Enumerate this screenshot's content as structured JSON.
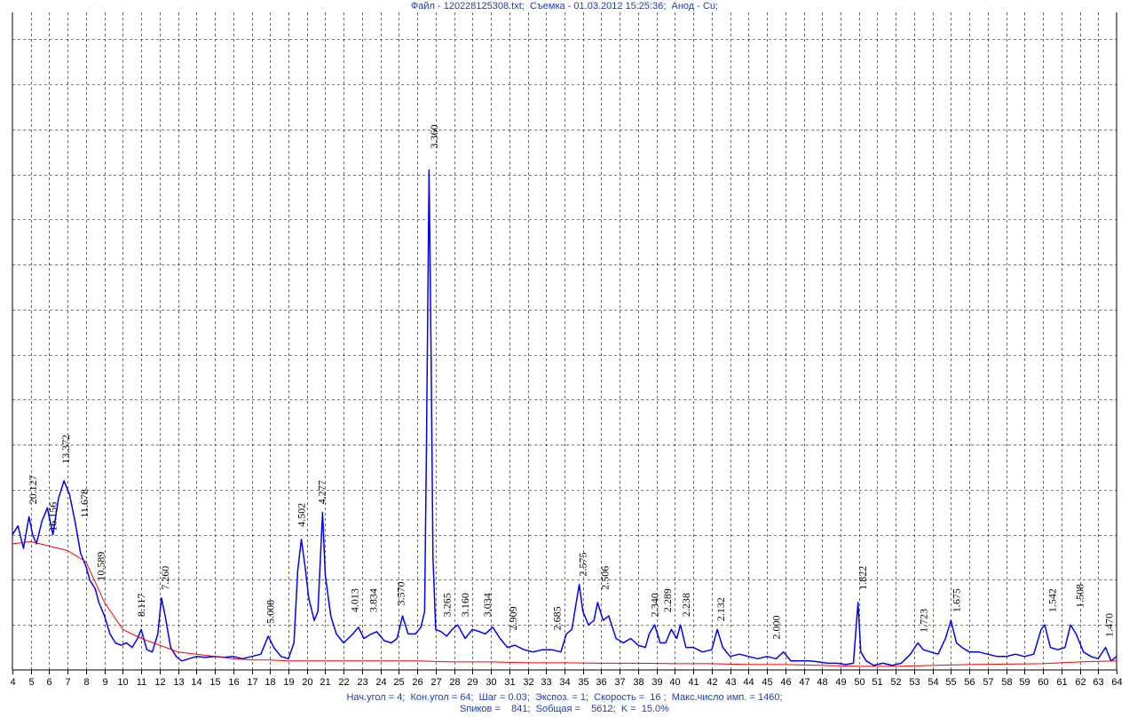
{
  "header": {
    "title": "Файл - 120228125308.txt;  Съемка - 01.03.2012 15:25:36;  Анод - Cu;"
  },
  "footer": {
    "line1": "Нач.угол = 4;  Кон.угол = 64;  Шаг = 0.03;  Экспоз. = 1;  Скорость =  16 ;  Макс.число имп. = 1460;",
    "line2": "Sпиков =    841;  Sобщая =    5612;  K =  15.0%"
  },
  "colors": {
    "trace": "#0000ff",
    "background_line": "#ff0000",
    "text": "#1a3fb8",
    "grid": "#000000"
  },
  "chart_data": {
    "type": "line",
    "title": "",
    "xlabel": "",
    "ylabel": "",
    "xlim": [
      4,
      64
    ],
    "ylim": [
      0,
      1460
    ],
    "x_ticks": [
      4,
      5,
      6,
      7,
      8,
      9,
      10,
      11,
      12,
      13,
      14,
      15,
      16,
      17,
      18,
      19,
      20,
      21,
      22,
      23,
      24,
      25,
      26,
      27,
      28,
      29,
      30,
      31,
      32,
      33,
      34,
      35,
      36,
      37,
      38,
      39,
      40,
      41,
      42,
      43,
      44,
      45,
      46,
      47,
      48,
      49,
      50,
      51,
      52,
      53,
      54,
      55,
      56,
      57,
      58,
      59,
      60,
      61,
      62,
      63,
      64
    ],
    "grid": "dashed",
    "series": [
      {
        "role": "pattern",
        "points": [
          [
            4.0,
            300
          ],
          [
            4.3,
            320
          ],
          [
            4.6,
            270
          ],
          [
            4.9,
            340
          ],
          [
            5.1,
            300
          ],
          [
            5.3,
            280
          ],
          [
            5.6,
            330
          ],
          [
            5.9,
            360
          ],
          [
            6.2,
            300
          ],
          [
            6.5,
            380
          ],
          [
            6.8,
            420
          ],
          [
            7.1,
            390
          ],
          [
            7.4,
            330
          ],
          [
            7.7,
            260
          ],
          [
            8.0,
            230
          ],
          [
            8.2,
            200
          ],
          [
            8.5,
            180
          ],
          [
            8.7,
            150
          ],
          [
            9.0,
            120
          ],
          [
            9.3,
            80
          ],
          [
            9.6,
            60
          ],
          [
            9.9,
            55
          ],
          [
            10.2,
            60
          ],
          [
            10.5,
            50
          ],
          [
            10.8,
            70
          ],
          [
            11.0,
            90
          ],
          [
            11.3,
            45
          ],
          [
            11.6,
            40
          ],
          [
            11.9,
            80
          ],
          [
            12.1,
            160
          ],
          [
            12.3,
            120
          ],
          [
            12.6,
            50
          ],
          [
            12.9,
            30
          ],
          [
            13.2,
            20
          ],
          [
            13.6,
            25
          ],
          [
            14.0,
            30
          ],
          [
            14.5,
            28
          ],
          [
            15.0,
            30
          ],
          [
            15.5,
            28
          ],
          [
            16.0,
            30
          ],
          [
            16.5,
            25
          ],
          [
            17.0,
            30
          ],
          [
            17.5,
            35
          ],
          [
            17.9,
            75
          ],
          [
            18.2,
            50
          ],
          [
            18.6,
            30
          ],
          [
            19.0,
            25
          ],
          [
            19.3,
            60
          ],
          [
            19.5,
            220
          ],
          [
            19.7,
            290
          ],
          [
            19.9,
            230
          ],
          [
            20.1,
            160
          ],
          [
            20.4,
            110
          ],
          [
            20.6,
            130
          ],
          [
            20.85,
            350
          ],
          [
            21.0,
            210
          ],
          [
            21.3,
            120
          ],
          [
            21.6,
            80
          ],
          [
            22.0,
            60
          ],
          [
            22.5,
            80
          ],
          [
            22.8,
            95
          ],
          [
            23.1,
            70
          ],
          [
            23.5,
            80
          ],
          [
            23.8,
            85
          ],
          [
            24.2,
            65
          ],
          [
            24.6,
            60
          ],
          [
            24.9,
            70
          ],
          [
            25.2,
            120
          ],
          [
            25.5,
            80
          ],
          [
            25.9,
            80
          ],
          [
            26.2,
            95
          ],
          [
            26.4,
            130
          ],
          [
            26.5,
            500
          ],
          [
            26.64,
            1110
          ],
          [
            26.75,
            700
          ],
          [
            26.85,
            250
          ],
          [
            27.0,
            90
          ],
          [
            27.3,
            85
          ],
          [
            27.6,
            75
          ],
          [
            27.9,
            90
          ],
          [
            28.2,
            100
          ],
          [
            28.6,
            70
          ],
          [
            29.0,
            90
          ],
          [
            29.4,
            85
          ],
          [
            29.7,
            80
          ],
          [
            30.1,
            95
          ],
          [
            30.5,
            70
          ],
          [
            30.9,
            50
          ],
          [
            31.3,
            55
          ],
          [
            31.8,
            45
          ],
          [
            32.3,
            40
          ],
          [
            32.8,
            45
          ],
          [
            33.3,
            45
          ],
          [
            33.8,
            40
          ],
          [
            34.1,
            80
          ],
          [
            34.4,
            90
          ],
          [
            34.8,
            190
          ],
          [
            35.0,
            130
          ],
          [
            35.3,
            100
          ],
          [
            35.6,
            110
          ],
          [
            35.8,
            150
          ],
          [
            36.1,
            110
          ],
          [
            36.4,
            120
          ],
          [
            36.8,
            70
          ],
          [
            37.2,
            60
          ],
          [
            37.6,
            70
          ],
          [
            38.0,
            55
          ],
          [
            38.4,
            50
          ],
          [
            38.6,
            80
          ],
          [
            38.9,
            100
          ],
          [
            39.2,
            60
          ],
          [
            39.5,
            60
          ],
          [
            39.8,
            90
          ],
          [
            40.1,
            70
          ],
          [
            40.3,
            100
          ],
          [
            40.6,
            50
          ],
          [
            41.0,
            50
          ],
          [
            41.5,
            40
          ],
          [
            42.0,
            45
          ],
          [
            42.3,
            90
          ],
          [
            42.6,
            50
          ],
          [
            43.0,
            30
          ],
          [
            43.5,
            35
          ],
          [
            44.0,
            30
          ],
          [
            44.5,
            25
          ],
          [
            45.0,
            30
          ],
          [
            45.5,
            25
          ],
          [
            45.9,
            40
          ],
          [
            46.3,
            20
          ],
          [
            46.8,
            20
          ],
          [
            47.3,
            20
          ],
          [
            47.8,
            18
          ],
          [
            48.3,
            15
          ],
          [
            48.8,
            15
          ],
          [
            49.3,
            12
          ],
          [
            49.7,
            15
          ],
          [
            49.95,
            150
          ],
          [
            50.1,
            40
          ],
          [
            50.4,
            20
          ],
          [
            50.8,
            10
          ],
          [
            51.3,
            15
          ],
          [
            51.8,
            10
          ],
          [
            52.3,
            15
          ],
          [
            52.8,
            35
          ],
          [
            53.2,
            60
          ],
          [
            53.5,
            45
          ],
          [
            53.9,
            40
          ],
          [
            54.3,
            35
          ],
          [
            54.7,
            70
          ],
          [
            55.0,
            110
          ],
          [
            55.3,
            60
          ],
          [
            55.6,
            50
          ],
          [
            56.0,
            40
          ],
          [
            56.5,
            40
          ],
          [
            57.0,
            35
          ],
          [
            57.5,
            30
          ],
          [
            58.0,
            30
          ],
          [
            58.5,
            35
          ],
          [
            59.0,
            30
          ],
          [
            59.5,
            35
          ],
          [
            59.9,
            90
          ],
          [
            60.1,
            100
          ],
          [
            60.4,
            50
          ],
          [
            60.8,
            45
          ],
          [
            61.2,
            50
          ],
          [
            61.5,
            100
          ],
          [
            61.8,
            80
          ],
          [
            62.2,
            40
          ],
          [
            62.6,
            30
          ],
          [
            63.0,
            25
          ],
          [
            63.4,
            50
          ],
          [
            63.7,
            20
          ],
          [
            64.0,
            30
          ]
        ]
      },
      {
        "role": "background",
        "points": [
          [
            4.0,
            280
          ],
          [
            5.0,
            285
          ],
          [
            6.0,
            275
          ],
          [
            7.0,
            265
          ],
          [
            8.0,
            240
          ],
          [
            9.0,
            150
          ],
          [
            10.0,
            90
          ],
          [
            11.0,
            70
          ],
          [
            12.0,
            55
          ],
          [
            13.0,
            40
          ],
          [
            14.0,
            35
          ],
          [
            15.0,
            30
          ],
          [
            16.0,
            25
          ],
          [
            17.0,
            22
          ],
          [
            18.0,
            22
          ],
          [
            19.0,
            20
          ],
          [
            20.0,
            20
          ],
          [
            22.0,
            20
          ],
          [
            24.0,
            20
          ],
          [
            26.0,
            20
          ],
          [
            28.0,
            18
          ],
          [
            30.0,
            18
          ],
          [
            32.0,
            16
          ],
          [
            34.0,
            16
          ],
          [
            36.0,
            15
          ],
          [
            38.0,
            15
          ],
          [
            40.0,
            14
          ],
          [
            42.0,
            14
          ],
          [
            44.0,
            12
          ],
          [
            46.0,
            12
          ],
          [
            48.0,
            10
          ],
          [
            50.0,
            8
          ],
          [
            52.0,
            8
          ],
          [
            54.0,
            10
          ],
          [
            56.0,
            12
          ],
          [
            58.0,
            13
          ],
          [
            60.0,
            14
          ],
          [
            62.0,
            18
          ],
          [
            64.0,
            20
          ]
        ]
      }
    ],
    "peak_labels": [
      {
        "x": 5.1,
        "y": 360,
        "label": "20.127"
      },
      {
        "x": 6.2,
        "y": 300,
        "label": "16.156"
      },
      {
        "x": 6.9,
        "y": 450,
        "label": "13.372"
      },
      {
        "x": 7.9,
        "y": 330,
        "label": "11.678"
      },
      {
        "x": 8.8,
        "y": 190,
        "label": "10.589"
      },
      {
        "x": 11.0,
        "y": 110,
        "label": "8.117"
      },
      {
        "x": 12.3,
        "y": 170,
        "label": "7.260"
      },
      {
        "x": 18.0,
        "y": 95,
        "label": "5.008"
      },
      {
        "x": 19.7,
        "y": 310,
        "label": "4.502"
      },
      {
        "x": 20.8,
        "y": 360,
        "label": "4.277"
      },
      {
        "x": 22.6,
        "y": 120,
        "label": "4.013"
      },
      {
        "x": 23.6,
        "y": 120,
        "label": "3.834"
      },
      {
        "x": 25.1,
        "y": 135,
        "label": "3.570"
      },
      {
        "x": 26.9,
        "y": 1150,
        "label": "3.360"
      },
      {
        "x": 27.6,
        "y": 110,
        "label": "3.265"
      },
      {
        "x": 28.6,
        "y": 110,
        "label": "3.160"
      },
      {
        "x": 29.8,
        "y": 110,
        "label": "3.034"
      },
      {
        "x": 31.2,
        "y": 80,
        "label": "2.909"
      },
      {
        "x": 33.6,
        "y": 80,
        "label": "2.685"
      },
      {
        "x": 35.0,
        "y": 200,
        "label": "2.575"
      },
      {
        "x": 36.2,
        "y": 170,
        "label": "2.506"
      },
      {
        "x": 38.9,
        "y": 110,
        "label": "2.340"
      },
      {
        "x": 39.6,
        "y": 120,
        "label": "2.289"
      },
      {
        "x": 40.6,
        "y": 110,
        "label": "2.238"
      },
      {
        "x": 42.5,
        "y": 100,
        "label": "2.132"
      },
      {
        "x": 45.5,
        "y": 60,
        "label": "2.000"
      },
      {
        "x": 50.2,
        "y": 170,
        "label": "1.822"
      },
      {
        "x": 53.5,
        "y": 75,
        "label": "1.723"
      },
      {
        "x": 55.3,
        "y": 120,
        "label": "1.675"
      },
      {
        "x": 60.5,
        "y": 120,
        "label": "1.542"
      },
      {
        "x": 62.0,
        "y": 130,
        "label": "1.508"
      },
      {
        "x": 63.6,
        "y": 65,
        "label": "1.470"
      }
    ]
  }
}
